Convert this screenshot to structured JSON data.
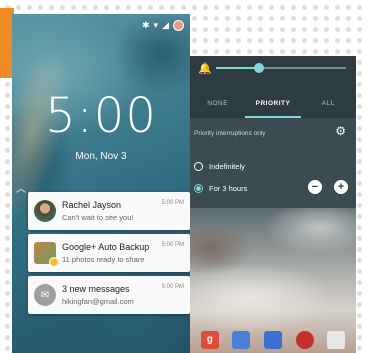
{
  "lock_screen": {
    "time": "5:00",
    "date": "Mon, Nov 3",
    "notifications": [
      {
        "title": "Rachel Jayson",
        "body": "Can't wait to see you!",
        "time": "5:00 PM",
        "avatar": "person-avatar"
      },
      {
        "title": "Google+ Auto Backup",
        "body": "11 photos ready to share",
        "time": "5:00 PM",
        "avatar": "photos-icon"
      },
      {
        "title": "3 new messages",
        "body": "hikingfan@gmail.com",
        "time": "5:00 PM",
        "avatar": "message-icon"
      }
    ]
  },
  "settings_panel": {
    "volume_level": 0.33,
    "tabs": [
      {
        "label": "NONE",
        "active": false
      },
      {
        "label": "PRIORITY",
        "active": true
      },
      {
        "label": "ALL",
        "active": false
      }
    ],
    "priority_label": "Priority interruptions only",
    "options": [
      {
        "label": "Indefinitely",
        "selected": false
      },
      {
        "label": "For 3 hours",
        "selected": true
      }
    ],
    "accent_color": "#7ed6d6"
  }
}
